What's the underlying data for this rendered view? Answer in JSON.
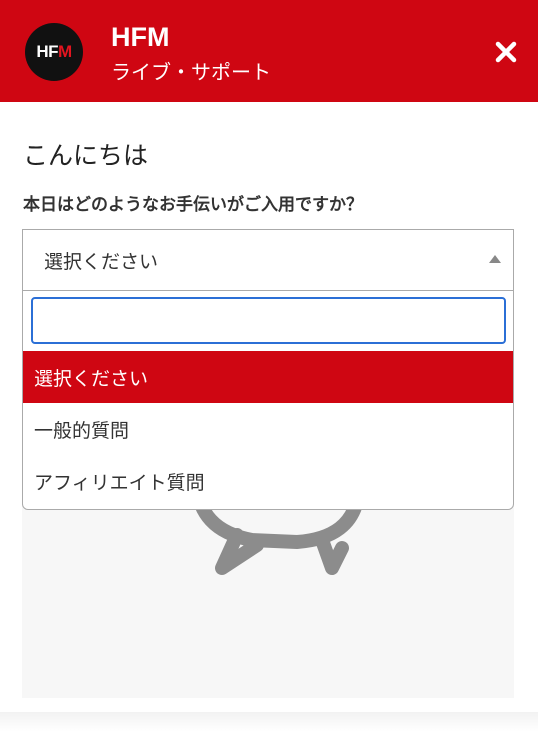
{
  "header": {
    "logo_text": "HFM",
    "brand": "HFM",
    "subtitle": "ライブ・サポート",
    "close_icon": "close-icon",
    "accent_color": "#cf0612"
  },
  "main": {
    "greeting": "こんにちは",
    "question": "本日はどのようなお手伝いがご入用ですか？",
    "select": {
      "selected_value": "選択ください",
      "search_value": "",
      "options": [
        {
          "label": "選択ください",
          "selected": true
        },
        {
          "label": "一般的質問",
          "selected": false
        },
        {
          "label": "アフィリエイト質問",
          "selected": false
        }
      ]
    },
    "illustration_icon": "chat-bubbles-icon"
  }
}
